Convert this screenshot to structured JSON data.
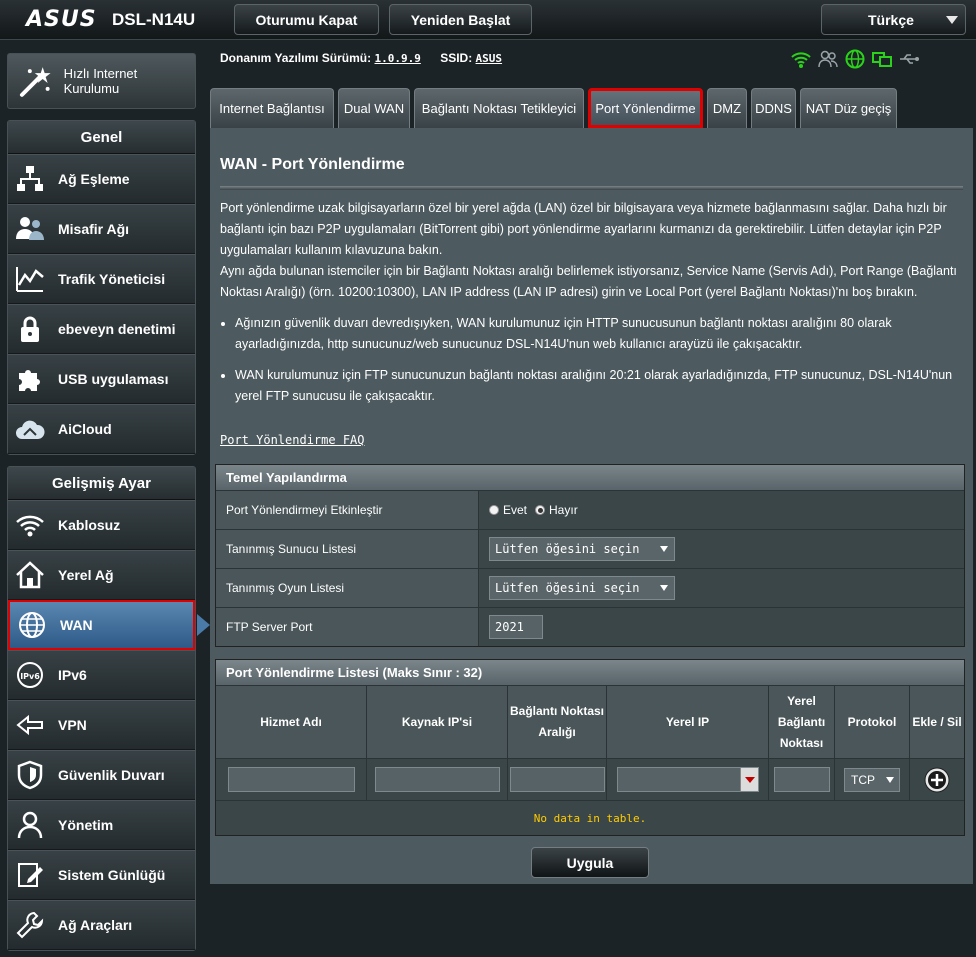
{
  "header": {
    "logo": "ASUS",
    "model": "DSL-N14U",
    "logout_label": "Oturumu Kapat",
    "reboot_label": "Yeniden Başlat",
    "language": "Türkçe"
  },
  "firmware": {
    "label": "Donanım Yazılımı Sürümü:",
    "version": "1.0.9.9",
    "ssid_label": "SSID:",
    "ssid": "ASUS"
  },
  "sidebar": {
    "quick_setup": "Hızlı Internet Kurulumu",
    "general_title": "Genel",
    "general_items": [
      {
        "label": "Ağ Eşleme"
      },
      {
        "label": "Misafir Ağı"
      },
      {
        "label": "Trafik Yöneticisi"
      },
      {
        "label": "ebeveyn denetimi"
      },
      {
        "label": "USB uygulaması"
      },
      {
        "label": "AiCloud"
      }
    ],
    "advanced_title": "Gelişmiş Ayar",
    "advanced_items": [
      {
        "label": "Kablosuz"
      },
      {
        "label": "Yerel Ağ"
      },
      {
        "label": "WAN"
      },
      {
        "label": "IPv6"
      },
      {
        "label": "VPN"
      },
      {
        "label": "Güvenlik Duvarı"
      },
      {
        "label": "Yönetim"
      },
      {
        "label": "Sistem Günlüğü"
      },
      {
        "label": "Ağ Araçları"
      }
    ]
  },
  "tabs": [
    {
      "label": "Internet Bağlantısı"
    },
    {
      "label": "Dual WAN"
    },
    {
      "label": "Bağlantı Noktası Tetikleyici"
    },
    {
      "label": "Port Yönlendirme"
    },
    {
      "label": "DMZ"
    },
    {
      "label": "DDNS"
    },
    {
      "label": "NAT Düz geçiş"
    }
  ],
  "page": {
    "title": "WAN - Port Yönlendirme",
    "desc1": "Port yönlendirme uzak bilgisayarların özel bir yerel ağda (LAN) özel bir bilgisayara veya hizmete bağlanmasını sağlar. Daha hızlı bir bağlantı için bazı P2P uygulamaları (BitTorrent gibi) port yönlendirme ayarlarını kurmanızı da gerektirebilir. Lütfen detaylar için P2P uygulamaları kullanım kılavuzuna bakın.",
    "desc2": "Aynı ağda bulunan istemciler için bir Bağlantı Noktası aralığı belirlemek istiyorsanız, Service Name (Servis Adı), Port Range (Bağlantı Noktası Aralığı) (örn. 10200:10300), LAN IP address (LAN IP adresi) girin ve Local Port (yerel Bağlantı Noktası)'nı boş bırakın.",
    "bullet1": "Ağınızın güvenlik duvarı devredışıyken, WAN kurulumunuz için HTTP sunucusunun bağlantı noktası aralığını 80 olarak ayarladığınızda, http sunucunuz/web sunucunuz DSL-N14U'nun web kullanıcı arayüzü ile çakışacaktır.",
    "bullet2": "WAN kurulumunuz için FTP sunucunuzun bağlantı noktası aralığını 20:21 olarak ayarladığınızda, FTP sunucunuz, DSL-N14U'nun yerel FTP sunucusu ile çakışacaktır.",
    "faq_link": "Port Yönlendirme FAQ"
  },
  "config": {
    "title": "Temel Yapılandırma",
    "enable_label": "Port Yönlendirmeyi Etkinleştir",
    "yes": "Evet",
    "no": "Hayır",
    "enabled": false,
    "server_list_label": "Tanınmış Sunucu Listesi",
    "server_list_value": "Lütfen öğesini seçin",
    "game_list_label": "Tanınmış Oyun Listesi",
    "game_list_value": "Lütfen öğesini seçin",
    "ftp_port_label": "FTP Server Port",
    "ftp_port_value": "2021"
  },
  "port_list": {
    "title": "Port Yönlendirme Listesi (Maks Sınır : 32)",
    "columns": [
      "Hizmet Adı",
      "Kaynak IP'si",
      "Bağlantı Noktası Aralığı",
      "Yerel IP",
      "Yerel Bağlantı Noktası",
      "Protokol",
      "Ekle / Sil"
    ],
    "protocol_value": "TCP",
    "empty_text": "No data in table."
  },
  "apply_label": "Uygula"
}
